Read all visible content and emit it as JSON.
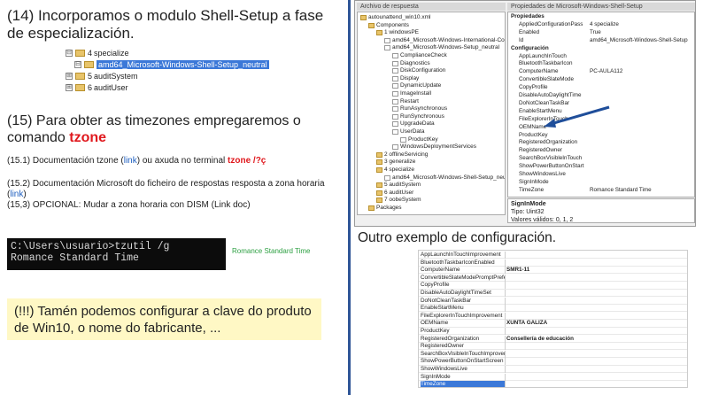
{
  "left": {
    "heading14": "(14) Incorporamos o modulo Shell-Setup a fase de especialización.",
    "tree": [
      {
        "exp": "⊟",
        "num": "4",
        "label": "specialize",
        "sel": false
      },
      {
        "exp": "⊟",
        "num": "",
        "label": "amd64_Microsoft-Windows-Shell-Setup_neutral",
        "sel": true
      },
      {
        "exp": "⊞",
        "num": "5",
        "label": "auditSystem",
        "sel": false
      },
      {
        "exp": "⊞",
        "num": "6",
        "label": "auditUser",
        "sel": false
      }
    ],
    "heading15_a": "(15) Para obter as timezones empregaremos o comando ",
    "heading15_kw": "tzone",
    "p151_a": "(15.1) Documentación tzone (",
    "p151_link": "link",
    "p151_b": ")  ou axuda no terminal ",
    "p151_cmd": "tzone /?ç",
    "p152_a": "(15.2) Documentación Microsoft do ficheiro de respostas resposta a zona horaria (",
    "p152_link": "link",
    "p152_b": ")",
    "p153": "(15,3) OPCIONAL: Mudar a zona horaria con DISM (Link doc)",
    "console_line1": "C:\\Users\\usuario>tzutil /g",
    "console_line2": "Romance Standard Time",
    "console_aside": "Romance Standard Time",
    "note": "(!!!) Tamén podemos configurar a clave do produto de Win10, o nome do fabricante, ..."
  },
  "screenshot_top": {
    "left_title": "Archivo de respuesta",
    "right_title": "Propiedades de Microsoft-Windows-Shell-Setup",
    "tree": [
      {
        "indent": 0,
        "folder": true,
        "label": "autounattend_win10.xml"
      },
      {
        "indent": 1,
        "folder": true,
        "label": "Components"
      },
      {
        "indent": 2,
        "folder": true,
        "label": "1 windowsPE"
      },
      {
        "indent": 3,
        "folder": false,
        "label": "amd64_Microsoft-Windows-International-Core-WinPE"
      },
      {
        "indent": 3,
        "folder": false,
        "label": "amd64_Microsoft-Windows-Setup_neutral"
      },
      {
        "indent": 4,
        "folder": false,
        "label": "ComplianceCheck"
      },
      {
        "indent": 4,
        "folder": false,
        "label": "Diagnostics"
      },
      {
        "indent": 4,
        "folder": false,
        "label": "DiskConfiguration"
      },
      {
        "indent": 4,
        "folder": false,
        "label": "Display"
      },
      {
        "indent": 4,
        "folder": false,
        "label": "DynamicUpdate"
      },
      {
        "indent": 4,
        "folder": false,
        "label": "ImageInstall"
      },
      {
        "indent": 4,
        "folder": false,
        "label": "Restart"
      },
      {
        "indent": 4,
        "folder": false,
        "label": "RunAsynchronous"
      },
      {
        "indent": 4,
        "folder": false,
        "label": "RunSynchronous"
      },
      {
        "indent": 4,
        "folder": false,
        "label": "UpgradeData"
      },
      {
        "indent": 4,
        "folder": false,
        "label": "UserData"
      },
      {
        "indent": 5,
        "folder": false,
        "label": "ProductKey"
      },
      {
        "indent": 4,
        "folder": false,
        "label": "WindowsDeploymentServices"
      },
      {
        "indent": 2,
        "folder": true,
        "label": "2 offlineServicing"
      },
      {
        "indent": 2,
        "folder": true,
        "label": "3 generalize"
      },
      {
        "indent": 2,
        "folder": true,
        "label": "4 specialize"
      },
      {
        "indent": 3,
        "folder": false,
        "label": "amd64_Microsoft-Windows-Shell-Setup_neutral"
      },
      {
        "indent": 2,
        "folder": true,
        "label": "5 auditSystem"
      },
      {
        "indent": 2,
        "folder": true,
        "label": "6 auditUser"
      },
      {
        "indent": 2,
        "folder": true,
        "label": "7 oobeSystem"
      },
      {
        "indent": 1,
        "folder": true,
        "label": "Packages"
      }
    ],
    "props": [
      {
        "cat": true,
        "k": "Propiedades",
        "v": ""
      },
      {
        "cat": false,
        "k": "AppliedConfigurationPass",
        "v": "4 specialize"
      },
      {
        "cat": false,
        "k": "Enabled",
        "v": "True"
      },
      {
        "cat": false,
        "k": "Id",
        "v": "amd64_Microsoft-Windows-Shell-Setup"
      },
      {
        "cat": true,
        "k": "Configuración",
        "v": ""
      },
      {
        "cat": false,
        "k": "AppLaunchInTouch",
        "v": ""
      },
      {
        "cat": false,
        "k": "BluetoothTaskbarIcon",
        "v": ""
      },
      {
        "cat": false,
        "k": "ComputerName",
        "v": "PC-AULA112"
      },
      {
        "cat": false,
        "k": "ConvertibleSlateMode",
        "v": ""
      },
      {
        "cat": false,
        "k": "CopyProfile",
        "v": ""
      },
      {
        "cat": false,
        "k": "DisableAutoDaylightTime",
        "v": ""
      },
      {
        "cat": false,
        "k": "DoNotCleanTaskBar",
        "v": ""
      },
      {
        "cat": false,
        "k": "EnableStartMenu",
        "v": ""
      },
      {
        "cat": false,
        "k": "FileExplorerInTouch",
        "v": ""
      },
      {
        "cat": false,
        "k": "OEMName",
        "v": ""
      },
      {
        "cat": false,
        "k": "ProductKey",
        "v": ""
      },
      {
        "cat": false,
        "k": "RegisteredOrganization",
        "v": ""
      },
      {
        "cat": false,
        "k": "RegisteredOwner",
        "v": ""
      },
      {
        "cat": false,
        "k": "SearchBoxVisibleInTouch",
        "v": ""
      },
      {
        "cat": false,
        "k": "ShowPowerButtonOnStart",
        "v": ""
      },
      {
        "cat": false,
        "k": "ShowWindowsLive",
        "v": ""
      },
      {
        "cat": false,
        "k": "SignInMode",
        "v": ""
      },
      {
        "cat": false,
        "k": "TimeZone",
        "v": "Romance Standard Time"
      }
    ],
    "bottom_title": "SignInMode",
    "bottom_type": "Tipo: Uint32",
    "bottom_vals": "Valores válidos: 0, 1, 2"
  },
  "caption": "Outro exemplo de configuración.",
  "table": [
    {
      "k": "AppLaunchInTouchImprovement",
      "v": ""
    },
    {
      "k": "BluetoothTaskbarIconEnabled",
      "v": ""
    },
    {
      "k": "ComputerName",
      "v": "SMR1-11"
    },
    {
      "k": "ConvertibleSlateModePromptPreference",
      "v": ""
    },
    {
      "k": "CopyProfile",
      "v": ""
    },
    {
      "k": "DisableAutoDaylightTimeSet",
      "v": ""
    },
    {
      "k": "DoNotCleanTaskBar",
      "v": ""
    },
    {
      "k": "EnableStartMenu",
      "v": ""
    },
    {
      "k": "FileExplorerInTouchImprovement",
      "v": ""
    },
    {
      "k": "OEMName",
      "v": "XUNTA GALIZA"
    },
    {
      "k": "ProductKey",
      "v": ""
    },
    {
      "k": "RegisteredOrganization",
      "v": "Consellería de educación"
    },
    {
      "k": "RegisteredOwner",
      "v": ""
    },
    {
      "k": "SearchBoxVisibleInTouchImprovement",
      "v": ""
    },
    {
      "k": "ShowPowerButtonOnStartScreen",
      "v": ""
    },
    {
      "k": "ShowWindowsLive",
      "v": ""
    },
    {
      "k": "SignInMode",
      "v": ""
    },
    {
      "k": "TimeZone",
      "v": "",
      "sel": true
    }
  ],
  "colors": {
    "divider": "#2f5597",
    "keyword": "#e0191e",
    "link": "#2060c0",
    "note_bg": "#fff8c5",
    "selection": "#3b78d8",
    "arrow": "#1f4e9a"
  }
}
